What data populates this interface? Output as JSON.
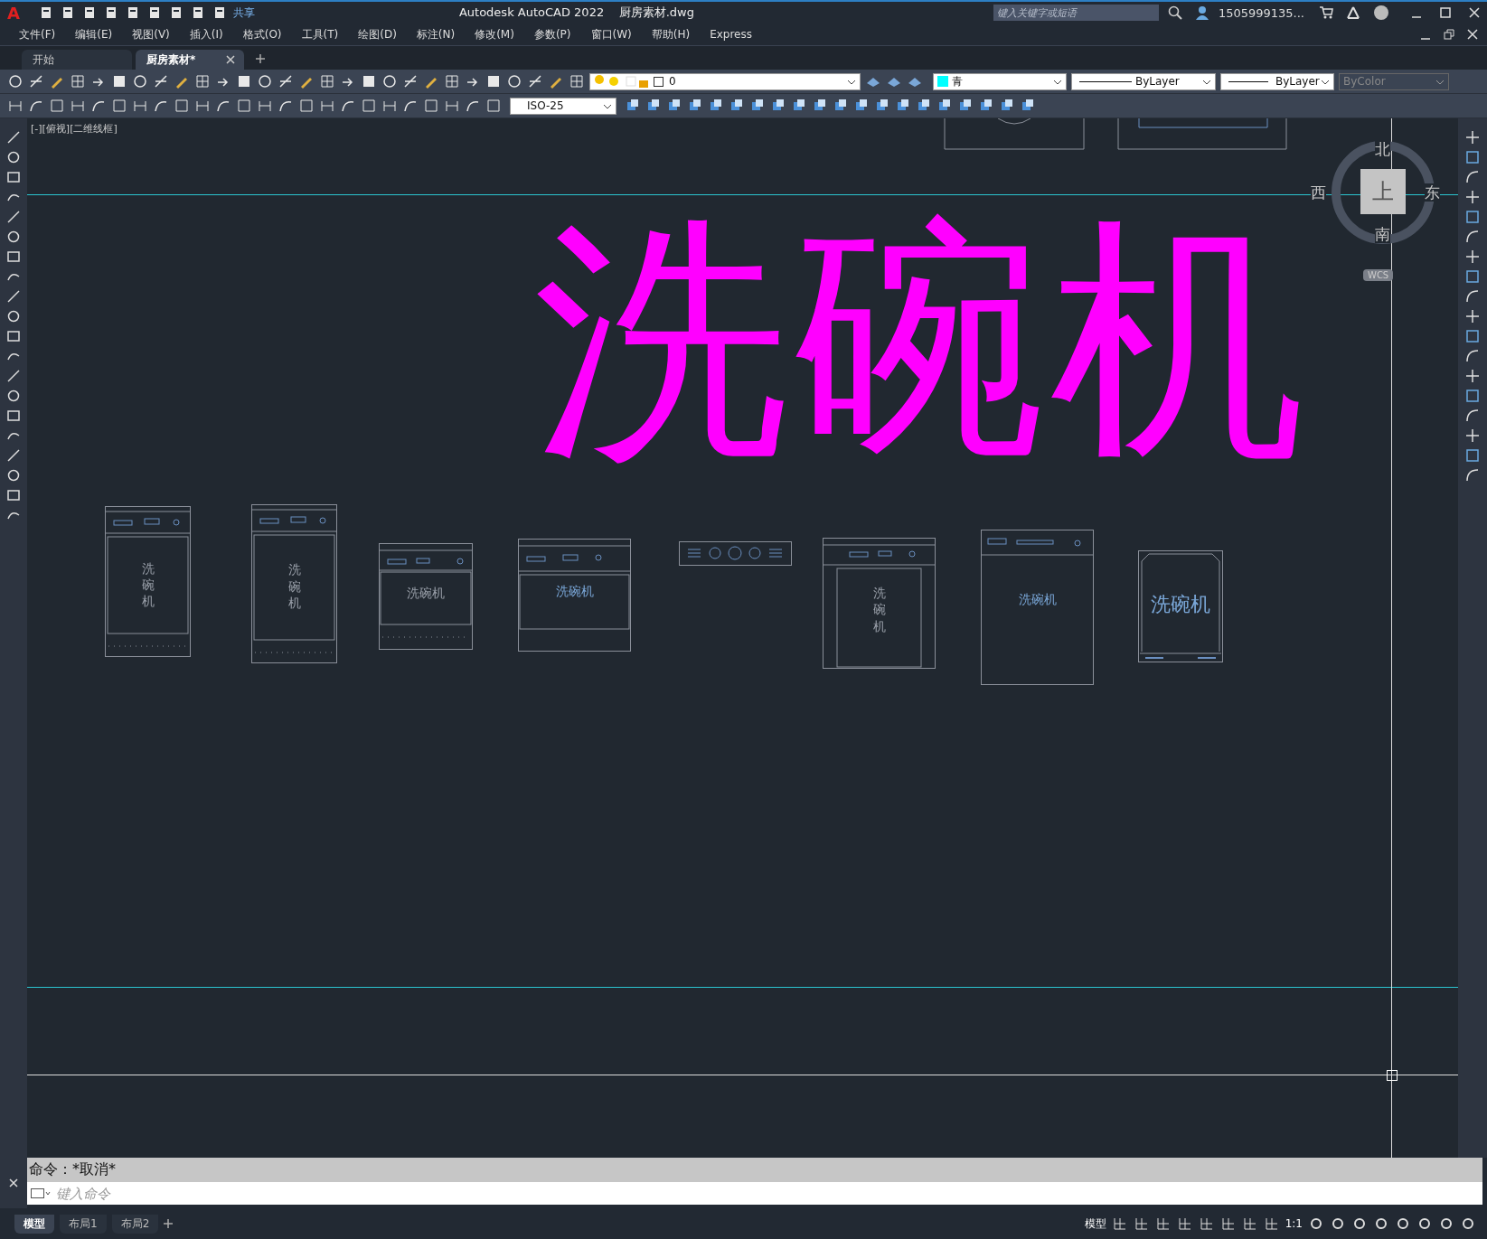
{
  "title_bar": {
    "logo": "A",
    "share": "共享",
    "title": "Autodesk AutoCAD 2022    厨房素材.dwg",
    "search_placeholder": "键入关键字或短语",
    "user": "1505999135..."
  },
  "menu": [
    "文件(F)",
    "编辑(E)",
    "视图(V)",
    "插入(I)",
    "格式(O)",
    "工具(T)",
    "绘图(D)",
    "标注(N)",
    "修改(M)",
    "参数(P)",
    "窗口(W)",
    "帮助(H)",
    "Express"
  ],
  "tabs": [
    {
      "label": "开始",
      "selected": false
    },
    {
      "label": "厨房素材*",
      "selected": true
    }
  ],
  "properties": {
    "layer": "0",
    "color": {
      "label": "青",
      "color": "#00ffff"
    },
    "linetype": "ByLayer",
    "lineweight": "ByLayer",
    "plot_style": {
      "label": "ByColor",
      "disabled": true
    },
    "dim_style": "ISO-25"
  },
  "viewport_label": "[-][俯视][二维线框]",
  "canvas": {
    "title_text": "洗碗机",
    "items": [
      {
        "kind": "tall",
        "label": "洗碗机",
        "vertical": true
      },
      {
        "kind": "tall",
        "label": "洗碗机",
        "vertical": true
      },
      {
        "kind": "short",
        "label": "洗碗机",
        "vertical": false
      },
      {
        "kind": "plain",
        "label": "洗碗机",
        "vertical": false
      },
      {
        "kind": "panel"
      },
      {
        "kind": "framed",
        "label": "洗碗机",
        "vertical": true
      },
      {
        "kind": "door",
        "label": "洗碗机",
        "vertical": false
      },
      {
        "kind": "rounded",
        "label": "洗碗机",
        "vertical": false
      }
    ]
  },
  "compass": {
    "north": "北",
    "south": "南",
    "east": "东",
    "west": "西",
    "top": "上",
    "wcs": "WCS"
  },
  "command": {
    "history": "命令：*取消*",
    "placeholder": "键入命令"
  },
  "layout_tabs": [
    {
      "label": "模型",
      "selected": true
    },
    {
      "label": "布局1",
      "selected": false
    },
    {
      "label": "布局2",
      "selected": false
    }
  ],
  "status_bar": {
    "model": "模型",
    "scale": "1:1"
  }
}
